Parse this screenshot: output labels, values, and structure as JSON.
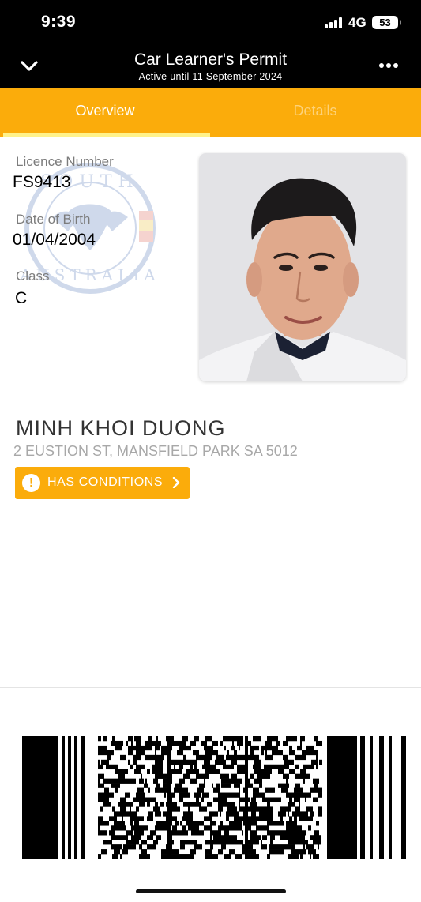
{
  "status_bar": {
    "time": "9:39",
    "network": "4G",
    "battery": "53"
  },
  "nav": {
    "title": "Car Learner's Permit",
    "subtitle": "Active until 11 September 2024"
  },
  "tabs": [
    {
      "label": "Overview",
      "active": true
    },
    {
      "label": "Details",
      "active": false
    }
  ],
  "licence": {
    "number_label": "Licence Number",
    "number": "FS9413",
    "dob_label": "Date of Birth",
    "dob": "01/04/2004",
    "class_label": "Class",
    "class": "C"
  },
  "seal": {
    "text": "SOUTH AUSTRALIA"
  },
  "holder": {
    "name": "MINH KHOI DUONG",
    "address": "2 EUSTION ST, MANSFIELD PARK SA 5012"
  },
  "conditions_button": {
    "label": "HAS CONDITIONS"
  },
  "colors": {
    "accent": "#fbac0b",
    "tab_indicator": "#fff28a",
    "header": "#000000",
    "label_grey": "#7c7c7c",
    "address_grey": "#a8a8a8"
  },
  "icons": {
    "back": "chevron-down-icon",
    "more": "more-horizontal-icon",
    "alert": "exclamation-circle-icon",
    "chevron": "chevron-right-icon"
  }
}
